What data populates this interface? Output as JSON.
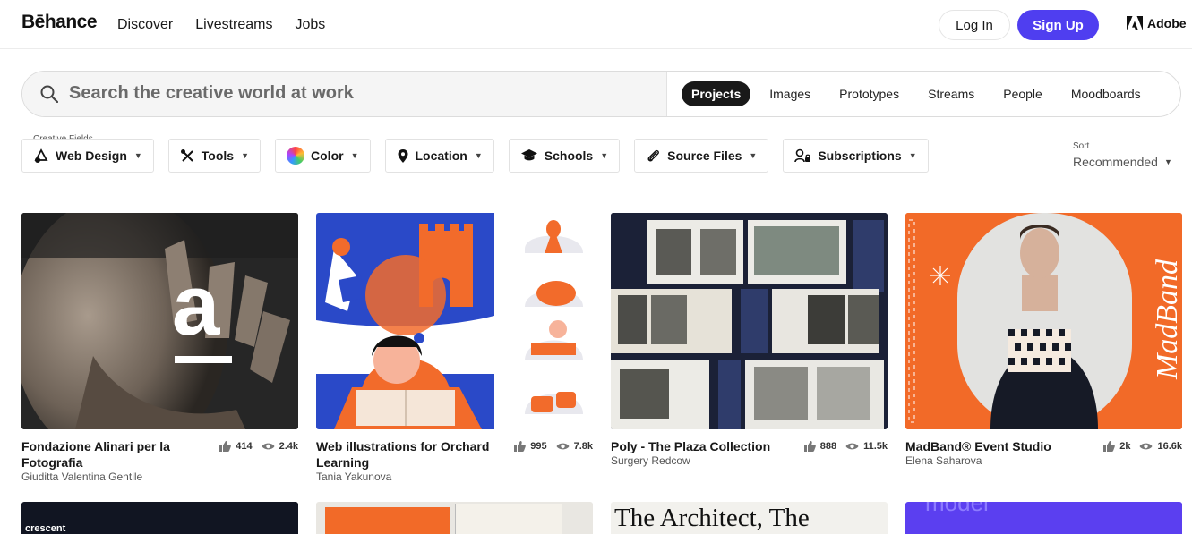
{
  "header": {
    "logo": "Bēhance",
    "nav": [
      "Discover",
      "Livestreams",
      "Jobs"
    ],
    "login": "Log In",
    "signup": "Sign Up",
    "adobe": "Adobe",
    "signup_color": "#4f3ef0"
  },
  "search": {
    "placeholder": "Search the creative world at work",
    "tabs": [
      "Projects",
      "Images",
      "Prototypes",
      "Streams",
      "People",
      "Moodboards"
    ],
    "active_tab": "Projects"
  },
  "filters": {
    "caption": "Creative Fields",
    "items": [
      {
        "label": "Web Design",
        "icon": "web-design-icon"
      },
      {
        "label": "Tools",
        "icon": "tools-icon"
      },
      {
        "label": "Color",
        "icon": "color-wheel-icon"
      },
      {
        "label": "Location",
        "icon": "location-pin-icon"
      },
      {
        "label": "Schools",
        "icon": "graduation-cap-icon"
      },
      {
        "label": "Source Files",
        "icon": "paperclip-icon"
      },
      {
        "label": "Subscriptions",
        "icon": "subscriptions-icon"
      }
    ],
    "sort_caption": "Sort",
    "sort_value": "Recommended"
  },
  "projects": [
    {
      "title": "Fondazione Alinari per la Fotografia",
      "owner": "Giuditta Valentina Gentile",
      "likes": "414",
      "views": "2.4k"
    },
    {
      "title": "Web illustrations for Orchard Learning",
      "owner": "Tania Yakunova",
      "likes": "995",
      "views": "7.8k"
    },
    {
      "title": "Poly - The Plaza Collection",
      "owner": "Surgery Redcow",
      "likes": "888",
      "views": "11.5k"
    },
    {
      "title": "MadBand® Event Studio",
      "owner": "Elena Saharova",
      "likes": "2k",
      "views": "16.6k"
    }
  ],
  "row2": {
    "card1_text": "crescent",
    "card3_text": "The Architect, The",
    "card4_text": "model"
  },
  "art": {
    "card1_letter": "a",
    "card4_brand": "MadBand"
  }
}
